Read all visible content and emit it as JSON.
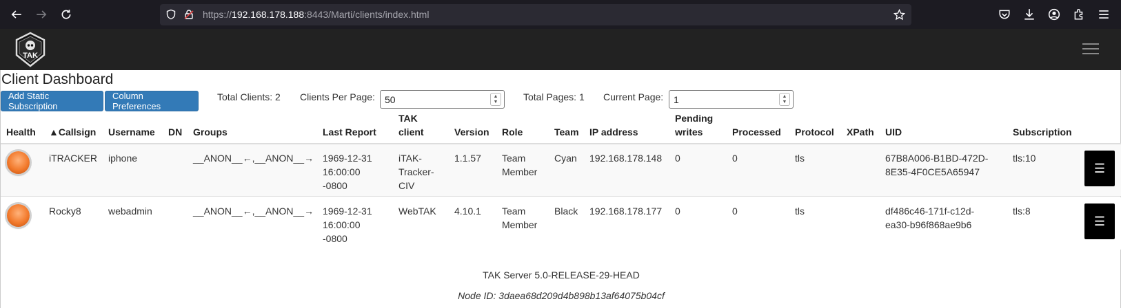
{
  "browser": {
    "url_scheme": "https://",
    "url_host": "192.168.178.188",
    "url_rest": ":8443/Marti/clients/index.html"
  },
  "app": {
    "logo_text": "TAK"
  },
  "page": {
    "title": "Client Dashboard",
    "buttons": {
      "add_subscription": "Add Static Subscription",
      "column_preferences": "Column Preferences"
    },
    "stats": {
      "total_clients": "Total Clients: 2",
      "clients_per_page_label": "Clients Per Page:",
      "clients_per_page_value": "50",
      "total_pages": "Total Pages: 1",
      "current_page_label": "Current Page:",
      "current_page_value": "1"
    }
  },
  "table": {
    "headers": {
      "health": "Health",
      "callsign": "▲Callsign",
      "username": "Username",
      "dn": "DN",
      "groups": "Groups",
      "last_report": "Last Report",
      "tak_client_1": "TAK",
      "tak_client_2": "client",
      "version": "Version",
      "role": "Role",
      "team": "Team",
      "ip": "IP address",
      "pending_1": "Pending",
      "pending_2": "writes",
      "processed": "Processed",
      "protocol": "Protocol",
      "xpath": "XPath",
      "uid": "UID",
      "subscription": "Subscription"
    },
    "rows": [
      {
        "callsign": "iTRACKER",
        "username": "iphone",
        "dn": "",
        "groups": "__ANON__←,__ANON__→",
        "last_report_1": "1969-12-31",
        "last_report_2": "16:00:00",
        "last_report_3": "-0800",
        "tak_client_1": "iTAK-",
        "tak_client_2": "Tracker-",
        "tak_client_3": "CIV",
        "version": "1.1.57",
        "role_1": "Team",
        "role_2": "Member",
        "team": "Cyan",
        "ip": "192.168.178.148",
        "pending": "0",
        "processed": "0",
        "protocol": "tls",
        "xpath": "",
        "uid_1": "67B8A006-B1BD-472D-",
        "uid_2": "8E35-4F0CE5A65947",
        "subscription": "tls:10",
        "menu": "☰"
      },
      {
        "callsign": "Rocky8",
        "username": "webadmin",
        "dn": "",
        "groups": "__ANON__←,__ANON__→",
        "last_report_1": "1969-12-31",
        "last_report_2": "16:00:00",
        "last_report_3": "-0800",
        "tak_client_1": "WebTAK",
        "version": "4.10.1",
        "role_1": "Team",
        "role_2": "Member",
        "team": "Black",
        "ip": "192.168.178.177",
        "pending": "0",
        "processed": "0",
        "protocol": "tls",
        "xpath": "",
        "uid_1": "df486c46-171f-c12d-",
        "uid_2": "ea30-b96f868ae9b6",
        "subscription": "tls:8",
        "menu": "☰"
      }
    ]
  },
  "footer": {
    "version": "TAK Server 5.0-RELEASE-29-HEAD",
    "node_id": "Node ID: 3daea68d209d4b898b13af64075b04cf"
  },
  "colors": {
    "primary_button": "#337ab7",
    "navbar": "#222222",
    "health_orb": "#f27a2c"
  }
}
